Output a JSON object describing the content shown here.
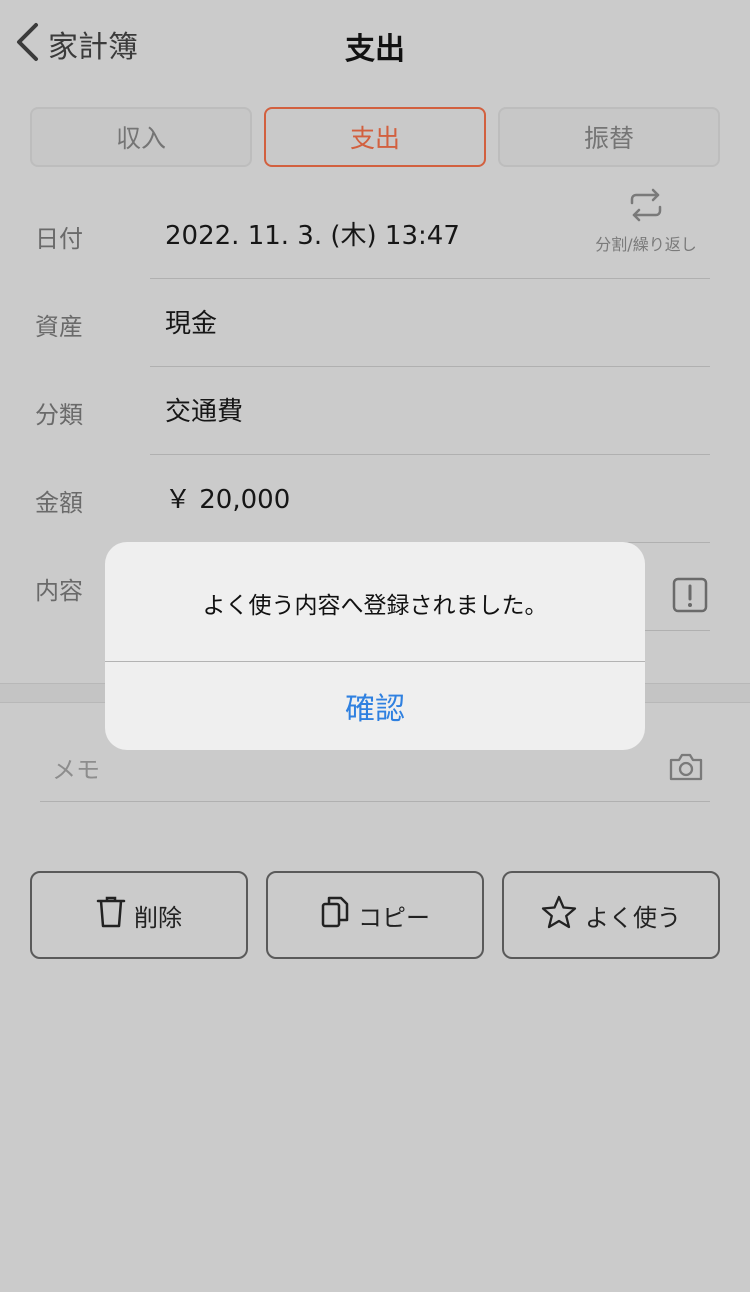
{
  "nav": {
    "back_label": "家計簿",
    "title": "支出"
  },
  "tabs": [
    {
      "label": "収入",
      "active": false
    },
    {
      "label": "支出",
      "active": true
    },
    {
      "label": "振替",
      "active": false
    }
  ],
  "form": {
    "date": {
      "label": "日付",
      "value": "2022. 11. 3. (木)   13:47",
      "repeat_label": "分割/繰り返し",
      "repeat_icon": "repeat-icon"
    },
    "asset": {
      "label": "資産",
      "value": "現金"
    },
    "category": {
      "label": "分類",
      "value": "交通費"
    },
    "amount": {
      "label": "金額",
      "value": "￥ 20,000"
    },
    "content": {
      "label": "内容",
      "value": "",
      "warn_icon": "warning-icon"
    }
  },
  "memo": {
    "placeholder": "メモ",
    "camera_icon": "camera-icon"
  },
  "actions": {
    "delete_label": "削除",
    "copy_label": "コピー",
    "favorite_label": "よく使う"
  },
  "dialog": {
    "message": "よく使う内容へ登録されました。",
    "confirm_label": "確認"
  },
  "colors": {
    "accent": "#d2603f",
    "link": "#2f80e0",
    "background": "#cbcbcb"
  }
}
